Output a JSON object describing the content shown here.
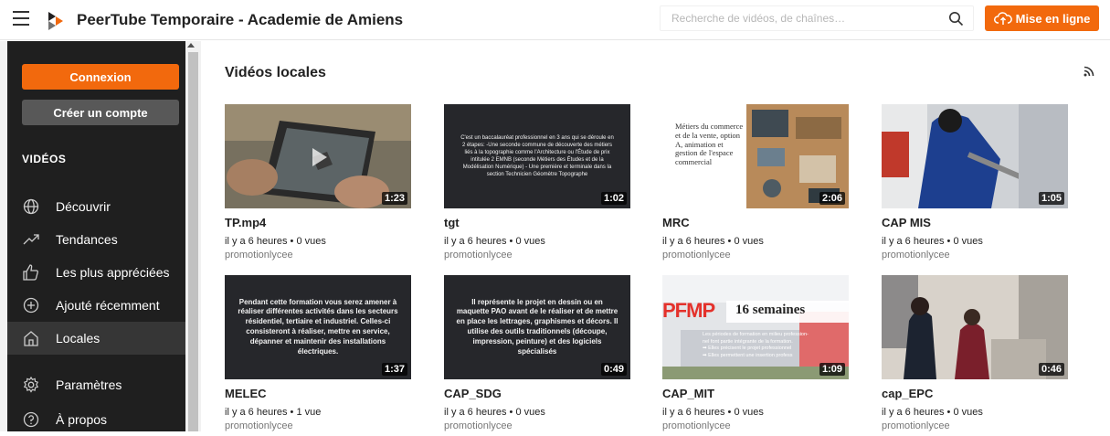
{
  "header": {
    "app_title": "PeerTube Temporaire - Academie de Amiens",
    "search_placeholder": "Recherche de vidéos, de chaînes…",
    "upload_label": "Mise en ligne"
  },
  "sidebar": {
    "login_label": "Connexion",
    "register_label": "Créer un compte",
    "section_title": "VIDÉOS",
    "items": [
      {
        "label": "Découvrir",
        "icon": "globe-icon"
      },
      {
        "label": "Tendances",
        "icon": "trending-icon"
      },
      {
        "label": "Les plus appréciées",
        "icon": "thumbs-up-icon"
      },
      {
        "label": "Ajouté récemment",
        "icon": "plus-circle-icon"
      },
      {
        "label": "Locales",
        "icon": "home-icon",
        "active": true
      },
      {
        "label": "Paramètres",
        "icon": "gear-icon"
      },
      {
        "label": "À propos",
        "icon": "help-circle-icon"
      }
    ]
  },
  "main": {
    "title": "Vidéos locales",
    "videos": [
      {
        "title": "TP.mp4",
        "meta": "il y a 6 heures • 0 vues",
        "channel": "promotionlycee",
        "duration": "1:23"
      },
      {
        "title": "tgt",
        "meta": "il y a 6 heures • 0 vues",
        "channel": "promotionlycee",
        "duration": "1:02",
        "thumb_text": "C'est un baccalauréat professionnel en 3 ans qui se déroule en 2 étapes: -Une seconde commune de découverte des métiers liés à la topographie comme l'Architecture ou l'Étude de prix intitulée 2 EMNB (seconde Métiers des Études et de la Modélisation Numérique) - Une première et terminale dans la section Technicien Géomètre Topographe"
      },
      {
        "title": "MRC",
        "meta": "il y a 6 heures • 0 vues",
        "channel": "promotionlycee",
        "duration": "2:06",
        "thumb_text": "Métiers du commerce et de la vente, option A, animation et gestion de l'espace commercial"
      },
      {
        "title": "CAP MIS",
        "meta": "il y a 6 heures • 0 vues",
        "channel": "promotionlycee",
        "duration": "1:05"
      },
      {
        "title": "MELEC",
        "meta": "il y a 6 heures • 1 vue",
        "channel": "promotionlycee",
        "duration": "1:37",
        "thumb_text": "Pendant cette formation vous serez amener à réaliser différentes activités dans les secteurs résidentiel, tertiaire et industriel. Celles-ci consisteront à réaliser, mettre en service, dépanner et maintenir des installations électriques."
      },
      {
        "title": "CAP_SDG",
        "meta": "il y a 6 heures • 0 vues",
        "channel": "promotionlycee",
        "duration": "0:49",
        "thumb_text": "Il représente le projet en dessin ou en maquette PAO avant de le réaliser et de mettre en place les lettrages, graphismes et décors. Il utilise des outils traditionnels (découpe, impression, peinture) et des logiciels spécialisés"
      },
      {
        "title": "CAP_MIT",
        "meta": "il y a 6 heures • 0 vues",
        "channel": "promotionlycee",
        "duration": "1:09",
        "thumb_pfmp": "PFMP",
        "thumb_weeks": "16 semaines",
        "thumb_lines": [
          "Les périodes de formation en milieu profession-",
          "nel font partie intégrante de la formation.",
          "➡ Elles précisent le projet professionnel",
          "➡ Elles permettent une insertion profess"
        ]
      },
      {
        "title": "cap_EPC",
        "meta": "il y a 6 heures • 0 vues",
        "channel": "promotionlycee",
        "duration": "0:46"
      }
    ]
  }
}
